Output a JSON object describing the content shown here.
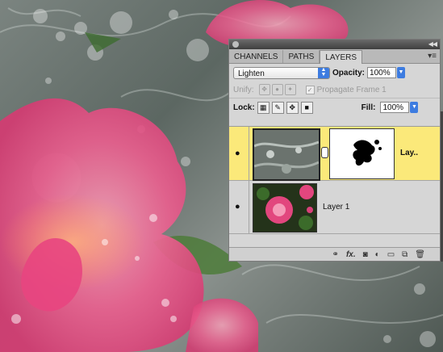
{
  "panel": {
    "tabs": [
      "CHANNELS",
      "PATHS",
      "LAYERS"
    ],
    "active_tab": "LAYERS",
    "menu_icon": "panel-menu-icon"
  },
  "blend": {
    "mode": "Lighten",
    "opacity_label": "Opacity:",
    "opacity_value": "100%"
  },
  "unify": {
    "label": "Unify:",
    "propagate_label": "Propagate Frame 1"
  },
  "lock": {
    "label": "Lock:",
    "fill_label": "Fill:",
    "fill_value": "100%"
  },
  "layers": [
    {
      "name": "Lay..",
      "selected": true,
      "has_mask": true
    },
    {
      "name": "Layer 1",
      "selected": false,
      "has_mask": false
    }
  ],
  "footer_icons": [
    "link-icon",
    "fx-icon",
    "add-mask-icon",
    "adjustment-icon",
    "new-group-icon",
    "new-layer-icon",
    "trash-icon"
  ],
  "colors": {
    "selected_layer": "#fbe97a",
    "accent": "#3d7ce0",
    "panel_bg": "#d6d6d6"
  }
}
